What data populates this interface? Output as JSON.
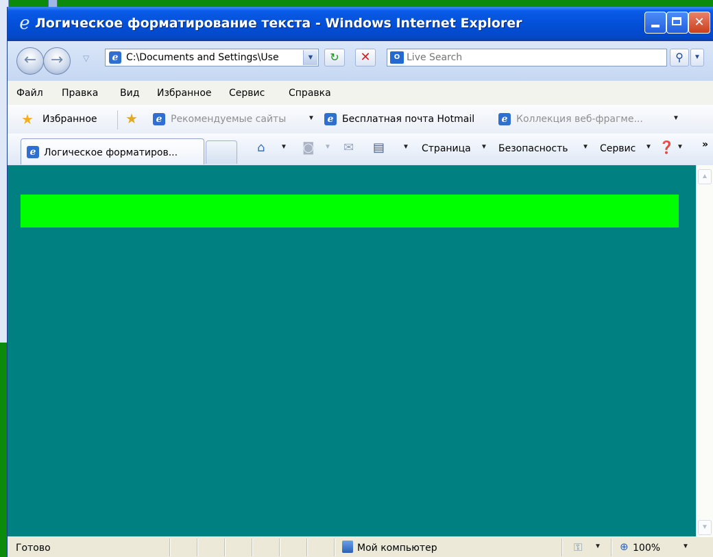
{
  "window": {
    "title": "Логическое форматирование текста - Windows Internet Explorer",
    "title_icon": "ie-e-icon",
    "controls": {
      "minimize": "minimize-icon",
      "maximize": "maximize-icon",
      "close": "✕"
    }
  },
  "address_bar": {
    "back_glyph": "←",
    "forward_glyph": "→",
    "url": "C:\\Documents and Settings\\Use",
    "refresh_glyph": "↻",
    "stop_glyph": "✕",
    "search_provider": "O",
    "search_placeholder": "Live Search",
    "search_glyph": "⚲"
  },
  "menu": {
    "items": [
      "Файл",
      "Правка",
      "Вид",
      "Избранное",
      "Сервис",
      "Справка"
    ]
  },
  "favorites_bar": {
    "label": "Избранное",
    "links": [
      "Рекомендуемые сайты",
      "Бесплатная почта Hotmail",
      "Коллекция веб-фрагме..."
    ]
  },
  "command_bar": {
    "tab_title": "Логическое форматиров...",
    "page_label": "Страница",
    "safety_label": "Безопасность",
    "tools_label": "Сервис",
    "more_glyph": "»"
  },
  "content": {
    "background": "#008080",
    "block_color": "#00ff00"
  },
  "status_bar": {
    "text": "Готово",
    "zone": "Мой компьютер",
    "zoom": "100%"
  }
}
